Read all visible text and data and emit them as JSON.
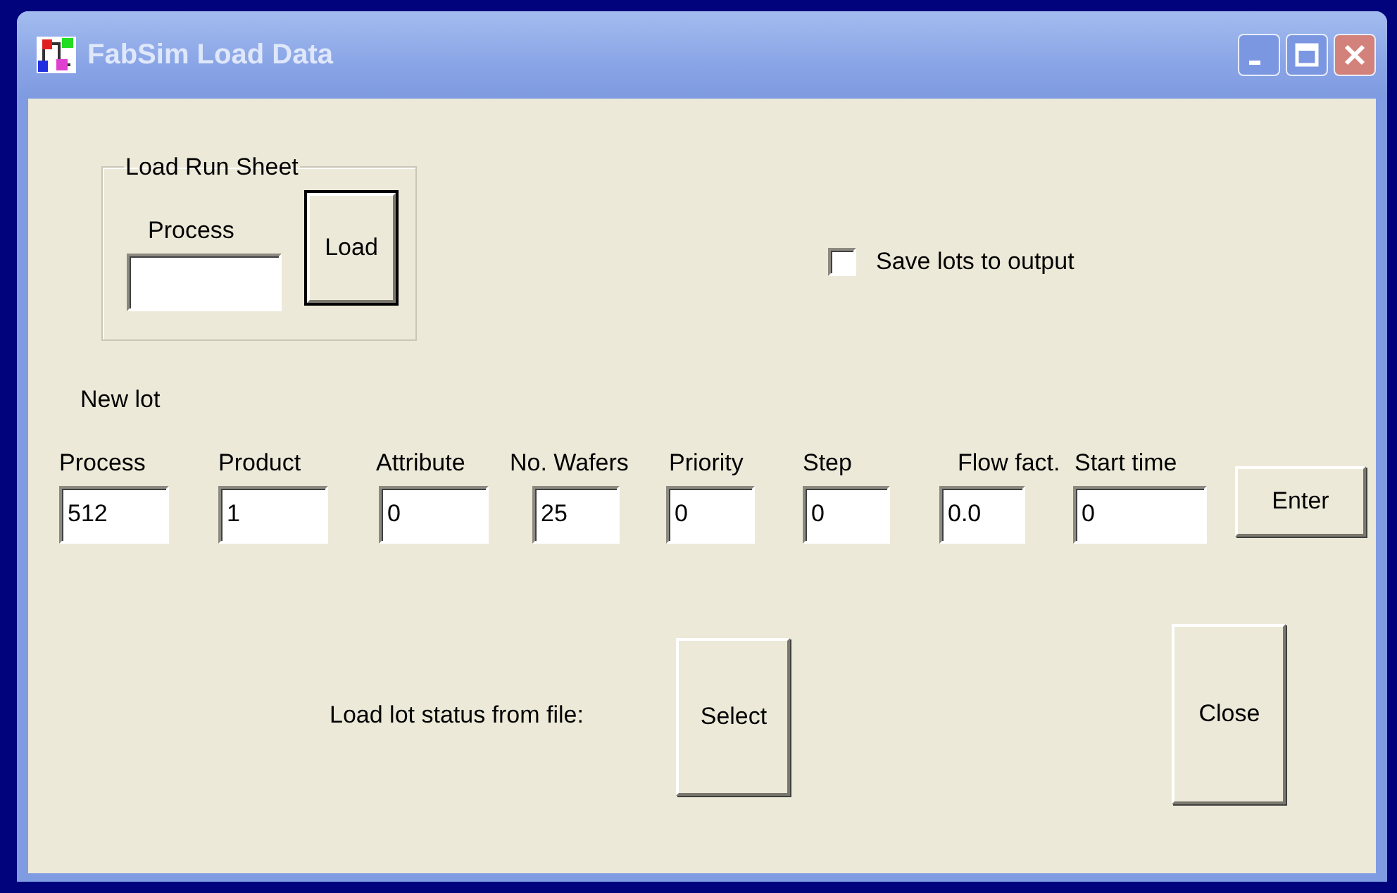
{
  "window": {
    "title": "FabSim Load Data"
  },
  "run_sheet": {
    "title": "Load Run Sheet",
    "field_label": "Process",
    "button": {
      "label": "Load",
      "default": true
    }
  },
  "save_lots": {
    "label": "Save lots to output",
    "checked": false
  },
  "new_lot": {
    "title": "New lot",
    "fields": [
      {
        "label": "Process",
        "value": "512"
      },
      {
        "label": "Product",
        "value": "1"
      },
      {
        "label": "Attribute",
        "value": "0"
      },
      {
        "label": "No. Wafers",
        "value": "25"
      },
      {
        "label": "Priority",
        "value": "0"
      },
      {
        "label": "Step",
        "value": "0"
      },
      {
        "label": "Flow fact.",
        "value": "0.0"
      },
      {
        "label": "Start time",
        "value": "0"
      }
    ],
    "button": {
      "label": "Enter",
      "default": false
    }
  },
  "status_file": {
    "label": "Load lot status from file:",
    "button": {
      "label": "Select",
      "default": false
    }
  },
  "close_button": {
    "label": "Close",
    "default": false
  }
}
